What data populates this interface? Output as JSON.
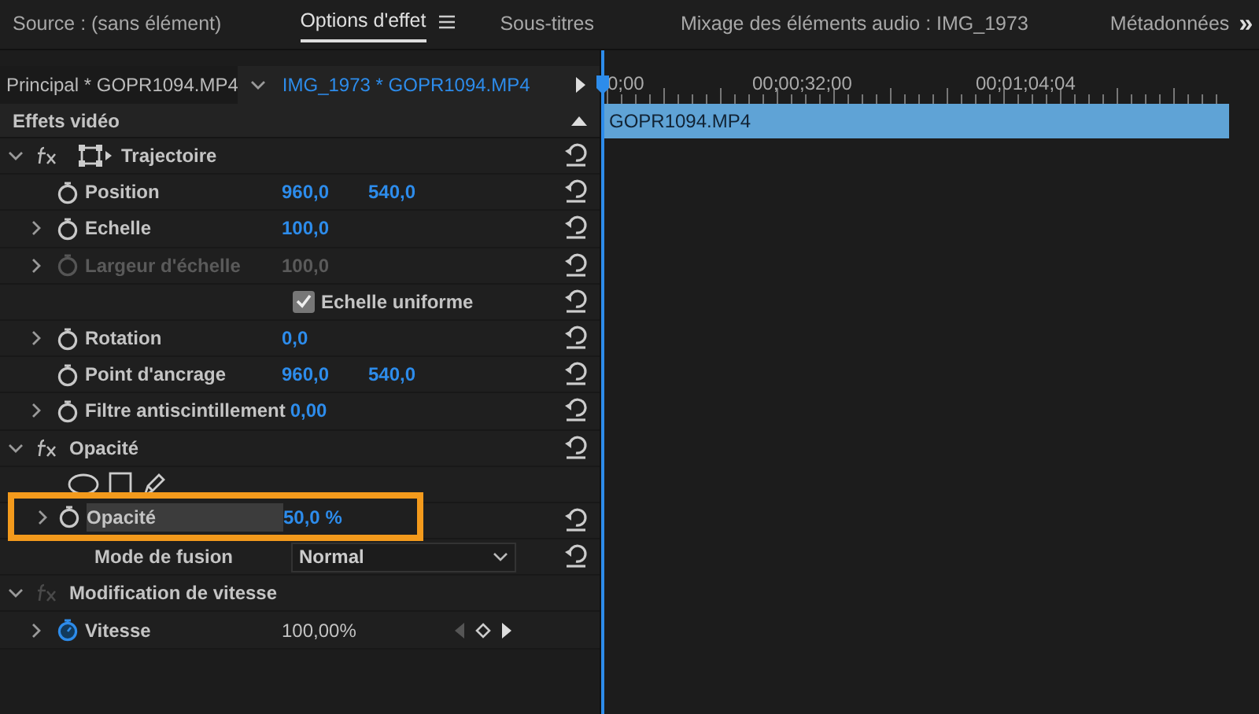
{
  "tabs": [
    {
      "label": "Source : (sans élément)",
      "selected": false
    },
    {
      "label": "Options d'effet",
      "selected": true,
      "menu": true
    },
    {
      "label": "Sous-titres",
      "selected": false
    },
    {
      "label": "Mixage des éléments audio : IMG_1973",
      "selected": false
    },
    {
      "label": "Métadonnées",
      "selected": false
    }
  ],
  "tabs_overflow": "»",
  "clip_header": {
    "master": "Principal * GOPR1094.MP4",
    "sequence_clip": "IMG_1973 * GOPR1094.MP4"
  },
  "section": "Effets vidéo",
  "rows": [
    {
      "kind": "effect",
      "label": "Trajectoire",
      "expanded": true,
      "fx_enabled": true,
      "transform_icon": true
    },
    {
      "kind": "param",
      "label": "Position",
      "values": [
        "960,0",
        "540,0"
      ],
      "disabled": false,
      "animated": false
    },
    {
      "kind": "param",
      "label": "Echelle",
      "values": [
        "100,0"
      ],
      "expandable": true,
      "disabled": false,
      "animated": false
    },
    {
      "kind": "param",
      "label": "Largeur d'échelle",
      "values": [
        "100,0"
      ],
      "expandable": true,
      "disabled": true,
      "animated": false
    },
    {
      "kind": "checkbox",
      "label": "Echelle uniforme",
      "checked": true
    },
    {
      "kind": "param",
      "label": "Rotation",
      "values": [
        "0,0"
      ],
      "expandable": true,
      "disabled": false,
      "animated": false
    },
    {
      "kind": "param",
      "label": "Point d'ancrage",
      "values": [
        "960,0",
        "540,0"
      ],
      "disabled": false,
      "animated": false
    },
    {
      "kind": "param",
      "label": "Filtre antiscintillement",
      "values": [
        "0,00"
      ],
      "expandable": true,
      "disabled": false,
      "animated": false
    },
    {
      "kind": "effect",
      "label": "Opacité",
      "expanded": true,
      "fx_enabled": true
    },
    {
      "kind": "masks"
    },
    {
      "kind": "param",
      "label": "Opacité",
      "values": [
        "50,0 %"
      ],
      "expandable": true,
      "disabled": false,
      "animated": false,
      "highlighted": true
    },
    {
      "kind": "dropdown",
      "label": "Mode de fusion",
      "value": "Normal"
    },
    {
      "kind": "effect",
      "label": "Modification de vitesse",
      "expanded": true,
      "fx_enabled": false,
      "no_reset": true
    },
    {
      "kind": "param",
      "label": "Vitesse",
      "values": [
        "100,00%"
      ],
      "expandable": true,
      "disabled": false,
      "animated": true,
      "keyframe_nav": true,
      "plain_value": true,
      "no_reset": true
    }
  ],
  "timeline": {
    "ruler": [
      "0;00",
      "00;00;32;00",
      "00;01;04;04"
    ],
    "clip": "GOPR1094.MP4"
  }
}
